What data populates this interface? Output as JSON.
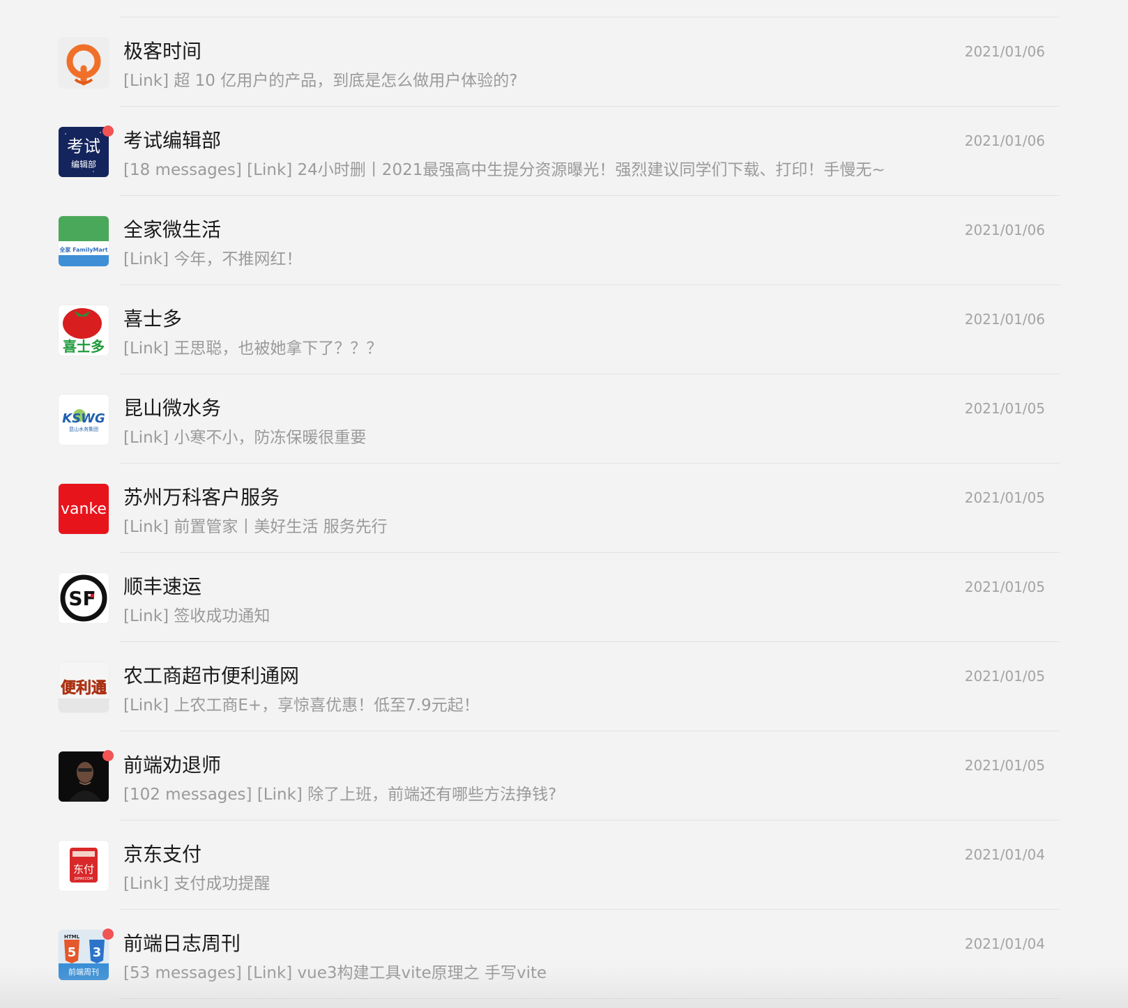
{
  "chats": [
    {
      "name": "极客时间",
      "preview": "[Link] 超 10 亿用户的产品，到底是怎么做用户体验的?",
      "date": "2021/01/06",
      "unread": false,
      "icon": "geektime-logo-icon"
    },
    {
      "name": "考试编辑部",
      "preview": "[18 messages] [Link] 24小时删丨2021最强高中生提分资源曝光！强烈建议同学们下载、打印！手慢无~",
      "date": "2021/01/06",
      "unread": true,
      "icon": "kaoshi-logo-icon",
      "avatar_text": "考试",
      "avatar_subtext": "编辑部"
    },
    {
      "name": "全家微生活",
      "preview": "[Link] 今年，不推网红！",
      "date": "2021/01/06",
      "unread": false,
      "icon": "familymart-logo-icon",
      "avatar_text": "全家 FamilyMart"
    },
    {
      "name": "喜士多",
      "preview": "[Link] 王思聪，也被她拿下了？？？",
      "date": "2021/01/06",
      "unread": false,
      "icon": "tomato-logo-icon",
      "avatar_text": "喜士多"
    },
    {
      "name": "昆山微水务",
      "preview": "[Link] 小寒不小，防冻保暖很重要",
      "date": "2021/01/05",
      "unread": false,
      "icon": "kswg-logo-icon",
      "avatar_text": "KSWG",
      "avatar_subtext": "昆山水务集团"
    },
    {
      "name": "苏州万科客户服务",
      "preview": "[Link] 前置管家丨美好生活 服务先行",
      "date": "2021/01/05",
      "unread": false,
      "icon": "vanke-logo-icon",
      "avatar_text": "vanke"
    },
    {
      "name": "顺丰速运",
      "preview": "[Link] 签收成功通知",
      "date": "2021/01/05",
      "unread": false,
      "icon": "sf-logo-icon",
      "avatar_text": "SF"
    },
    {
      "name": "农工商超市便利通网",
      "preview": "[Link] 上农工商E+，享惊喜优惠！低至7.9元起！",
      "date": "2021/01/05",
      "unread": false,
      "icon": "bianlitong-logo-icon",
      "avatar_text": "便利通"
    },
    {
      "name": "前端劝退师",
      "preview": "[102 messages] [Link] 除了上班，前端还有哪些方法挣钱?",
      "date": "2021/01/05",
      "unread": true,
      "icon": "portrait-avatar-icon"
    },
    {
      "name": "京东支付",
      "preview": "[Link] 支付成功提醒",
      "date": "2021/01/04",
      "unread": false,
      "icon": "jdpay-logo-icon",
      "avatar_text": "东付",
      "avatar_subtext": "JDPAY.COM"
    },
    {
      "name": "前端日志周刊",
      "preview": "[53 messages] [Link] vue3构建工具vite原理之 手写vite",
      "date": "2021/01/04",
      "unread": true,
      "icon": "html5-css3-logo-icon",
      "avatar_text": "HTML",
      "avatar_subtext": "前端周刊"
    }
  ],
  "colors": {
    "background": "#f3f3f3",
    "name": "#1a1a1a",
    "preview": "#9a9a9a",
    "date": "#a3a3a3",
    "badge": "#f25353",
    "divider": "#e2e2e2"
  }
}
